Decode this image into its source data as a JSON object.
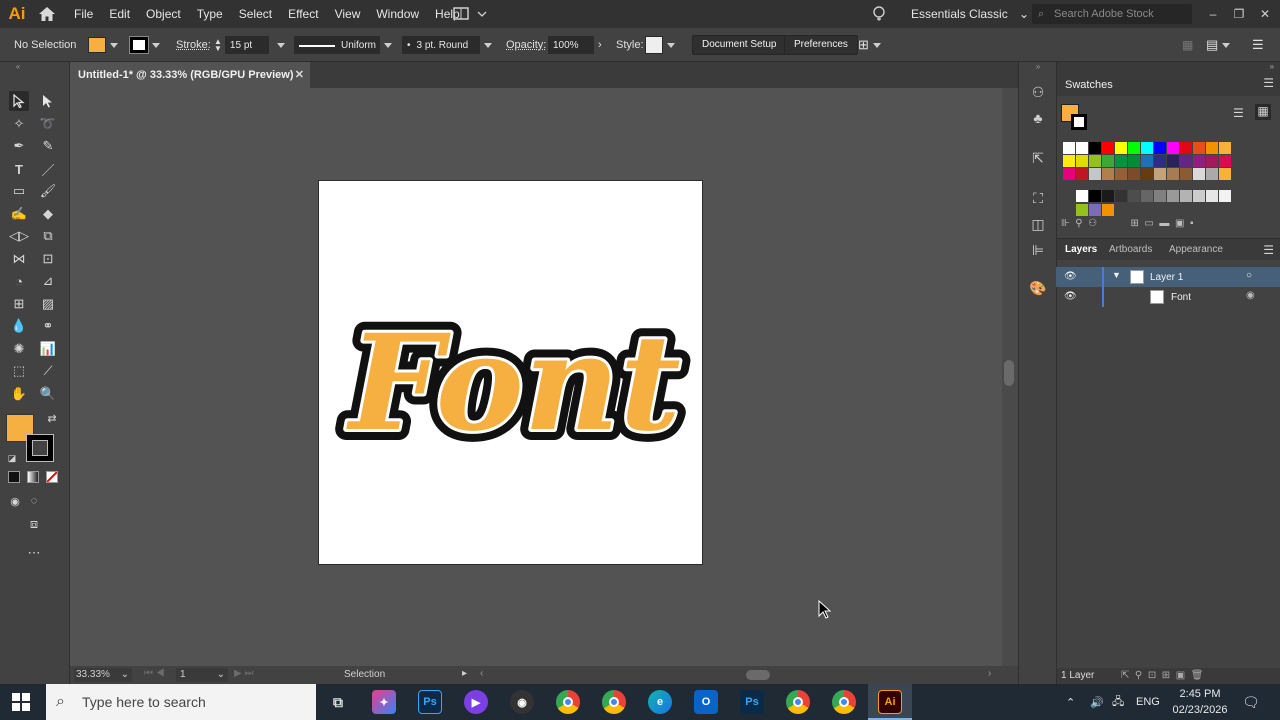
{
  "app": {
    "logo": "Ai",
    "workspace": "Essentials Classic",
    "stock_search_placeholder": "Search Adobe Stock"
  },
  "menu": [
    "File",
    "Edit",
    "Object",
    "Type",
    "Select",
    "Effect",
    "View",
    "Window",
    "Help"
  ],
  "control_bar": {
    "selection": "No Selection",
    "stroke_label": "Stroke:",
    "stroke_weight": "15 pt",
    "profile": "Uniform",
    "brush": "3 pt. Round",
    "opacity_label": "Opacity:",
    "opacity": "100%",
    "style_label": "Style:",
    "document_setup": "Document Setup",
    "preferences": "Preferences"
  },
  "document": {
    "tab_title": "Untitled-1* @ 33.33% (RGB/GPU Preview)",
    "artwork_text": "Font"
  },
  "status_bar": {
    "zoom": "33.33%",
    "artboard": "1",
    "tool": "Selection"
  },
  "panels": {
    "swatches_title": "Swatches",
    "tabs": [
      "Layers",
      "Artboards",
      "Appearance"
    ],
    "layers": [
      {
        "name": "Layer 1"
      },
      {
        "name": "Font"
      }
    ],
    "layer_count": "1 Layer"
  },
  "taskbar": {
    "search_placeholder": "Type here to search",
    "language": "ENG",
    "time": "2:45 PM",
    "date": "02/23/2026"
  },
  "colors": {
    "fill": "#f5b041",
    "accent_orange": "#ff9a00",
    "layer_highlight": "#46607a"
  },
  "icons": [
    "home-icon",
    "search-icon",
    "selection-tool-icon",
    "direct-selection-icon",
    "pen-icon",
    "type-icon",
    "rectangle-icon",
    "brush-icon",
    "hand-icon",
    "zoom-icon",
    "eye-icon",
    "windows-start-icon"
  ]
}
